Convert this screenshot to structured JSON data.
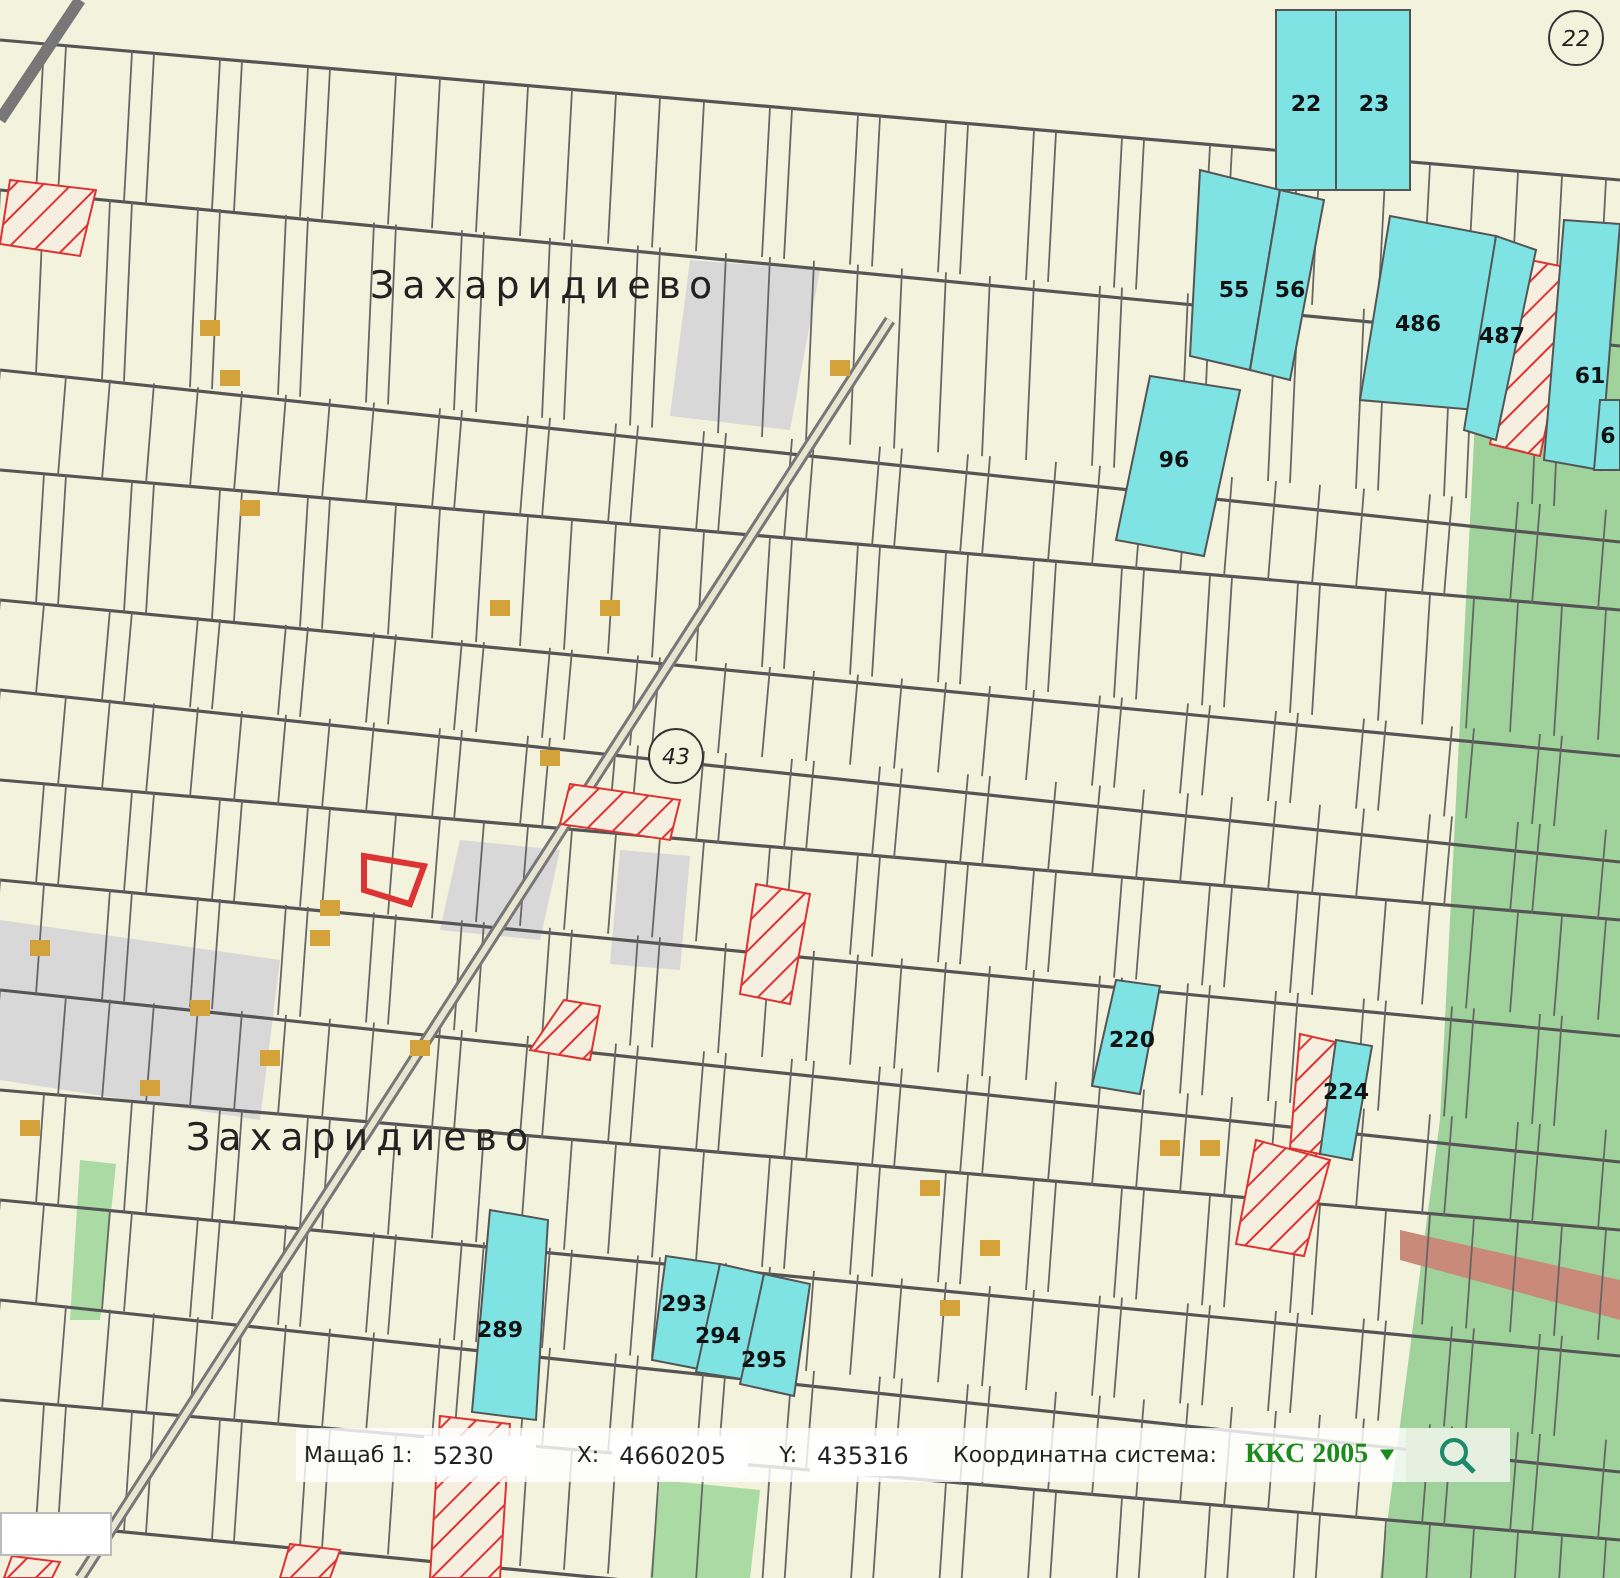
{
  "map": {
    "place_labels": [
      "Захаридиево",
      "Захаридиево"
    ],
    "road_numbers": [
      "22",
      "43"
    ],
    "parcels": [
      {
        "number": "22"
      },
      {
        "number": "23"
      },
      {
        "number": "55"
      },
      {
        "number": "56"
      },
      {
        "number": "486"
      },
      {
        "number": "487"
      },
      {
        "number": "61"
      },
      {
        "number": "6"
      },
      {
        "number": "96"
      },
      {
        "number": "220"
      },
      {
        "number": "224"
      },
      {
        "number": "289"
      },
      {
        "number": "293"
      },
      {
        "number": "294"
      },
      {
        "number": "295"
      }
    ]
  },
  "coordinate_bar": {
    "scale_label": "Мащаб 1:",
    "scale_value": "5230",
    "x_label": "X:",
    "x_value": "4660205",
    "y_label": "Y:",
    "y_value": "435316",
    "system_label": "Координатна система:",
    "system_value": "ККС 2005"
  }
}
